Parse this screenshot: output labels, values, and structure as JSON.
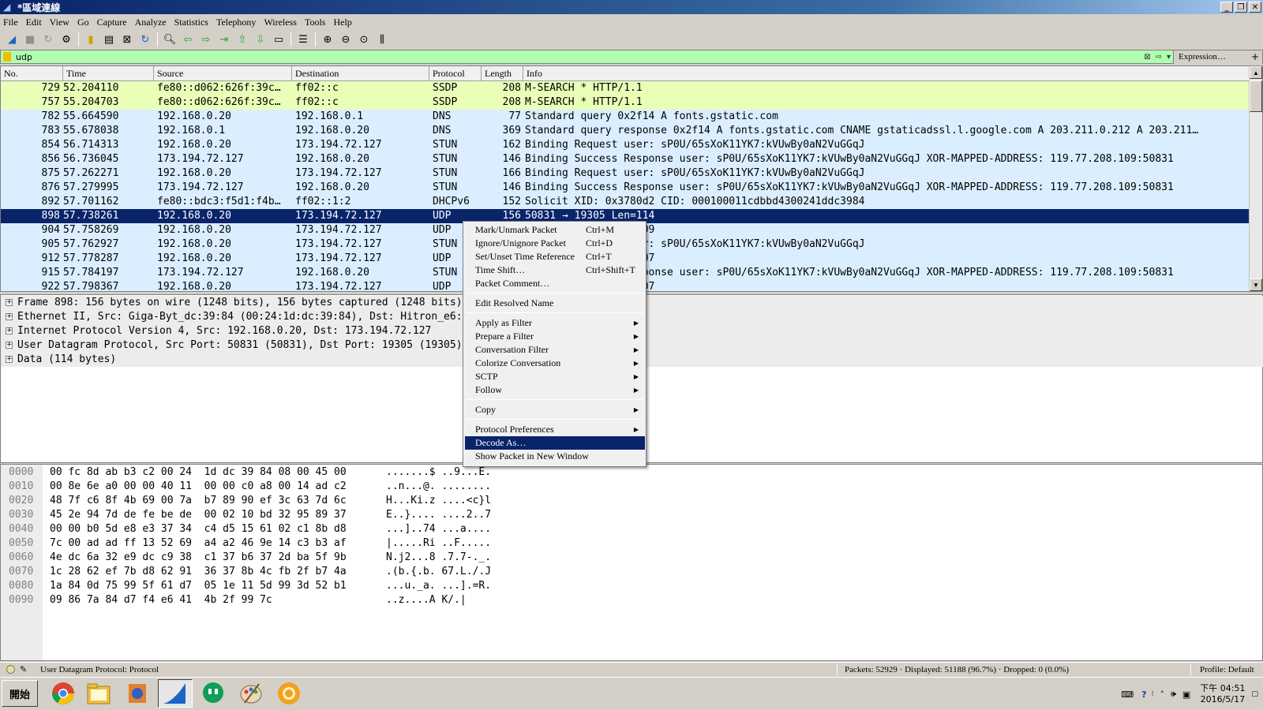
{
  "window": {
    "title": "*區域連線",
    "min": "_",
    "max": "❐",
    "close": "✕"
  },
  "menu": [
    "File",
    "Edit",
    "View",
    "Go",
    "Capture",
    "Analyze",
    "Statistics",
    "Telephony",
    "Wireless",
    "Tools",
    "Help"
  ],
  "filter": {
    "value": "udp",
    "expression_label": "Expression…",
    "plus": "+"
  },
  "columns": [
    "No.",
    "Time",
    "Source",
    "Destination",
    "Protocol",
    "Length",
    "Info"
  ],
  "packets": [
    {
      "no": "729",
      "time": "52.204110",
      "src": "fe80::d062:626f:39c…",
      "dst": "ff02::c",
      "proto": "SSDP",
      "len": "208",
      "info": "M-SEARCH * HTTP/1.1",
      "bg": "#e9ffb8"
    },
    {
      "no": "757",
      "time": "55.204703",
      "src": "fe80::d062:626f:39c…",
      "dst": "ff02::c",
      "proto": "SSDP",
      "len": "208",
      "info": "M-SEARCH * HTTP/1.1",
      "bg": "#e9ffb8"
    },
    {
      "no": "782",
      "time": "55.664590",
      "src": "192.168.0.20",
      "dst": "192.168.0.1",
      "proto": "DNS",
      "len": "77",
      "info": "Standard query 0x2f14 A fonts.gstatic.com",
      "bg": "#daeeff"
    },
    {
      "no": "783",
      "time": "55.678038",
      "src": "192.168.0.1",
      "dst": "192.168.0.20",
      "proto": "DNS",
      "len": "369",
      "info": "Standard query response 0x2f14 A fonts.gstatic.com CNAME gstaticadssl.l.google.com A 203.211.0.212 A 203.211…",
      "bg": "#daeeff"
    },
    {
      "no": "854",
      "time": "56.714313",
      "src": "192.168.0.20",
      "dst": "173.194.72.127",
      "proto": "STUN",
      "len": "162",
      "info": "Binding Request user: sP0U/65sXoK11YK7:kVUwBy0aN2VuGGqJ",
      "bg": "#daeeff"
    },
    {
      "no": "856",
      "time": "56.736045",
      "src": "173.194.72.127",
      "dst": "192.168.0.20",
      "proto": "STUN",
      "len": "146",
      "info": "Binding Success Response user: sP0U/65sXoK11YK7:kVUwBy0aN2VuGGqJ XOR-MAPPED-ADDRESS: 119.77.208.109:50831",
      "bg": "#daeeff"
    },
    {
      "no": "875",
      "time": "57.262271",
      "src": "192.168.0.20",
      "dst": "173.194.72.127",
      "proto": "STUN",
      "len": "166",
      "info": "Binding Request user: sP0U/65sXoK11YK7:kVUwBy0aN2VuGGqJ",
      "bg": "#daeeff"
    },
    {
      "no": "876",
      "time": "57.279995",
      "src": "173.194.72.127",
      "dst": "192.168.0.20",
      "proto": "STUN",
      "len": "146",
      "info": "Binding Success Response user: sP0U/65sXoK11YK7:kVUwBy0aN2VuGGqJ XOR-MAPPED-ADDRESS: 119.77.208.109:50831",
      "bg": "#daeeff"
    },
    {
      "no": "892",
      "time": "57.701162",
      "src": "fe80::bdc3:f5d1:f4b…",
      "dst": "ff02::1:2",
      "proto": "DHCPv6",
      "len": "152",
      "info": "Solicit XID: 0x3780d2 CID: 000100011cdbbd4300241ddc3984",
      "bg": "#daeeff"
    },
    {
      "no": "898",
      "time": "57.738261",
      "src": "192.168.0.20",
      "dst": "173.194.72.127",
      "proto": "UDP",
      "len": "156",
      "info": "50831 → 19305 Len=114",
      "bg": "#0a246a",
      "selected": true
    },
    {
      "no": "904",
      "time": "57.758269",
      "src": "192.168.0.20",
      "dst": "173.194.72.127",
      "proto": "UDP",
      "len": "151",
      "info": "50831 → 19305 Len=109",
      "bg": "#daeeff"
    },
    {
      "no": "905",
      "time": "57.762927",
      "src": "192.168.0.20",
      "dst": "173.194.72.127",
      "proto": "STUN",
      "len": "162",
      "info": "Binding Request user: sP0U/65sXoK11YK7:kVUwBy0aN2VuGGqJ",
      "bg": "#daeeff"
    },
    {
      "no": "912",
      "time": "57.778287",
      "src": "192.168.0.20",
      "dst": "173.194.72.127",
      "proto": "UDP",
      "len": "149",
      "info": "50831 → 19305 Len=107",
      "bg": "#daeeff"
    },
    {
      "no": "915",
      "time": "57.784197",
      "src": "173.194.72.127",
      "dst": "192.168.0.20",
      "proto": "STUN",
      "len": "146",
      "info": "Binding Success Response user: sP0U/65sXoK11YK7:kVUwBy0aN2VuGGqJ XOR-MAPPED-ADDRESS: 119.77.208.109:50831",
      "bg": "#daeeff"
    },
    {
      "no": "922",
      "time": "57.798367",
      "src": "192.168.0.20",
      "dst": "173.194.72.127",
      "proto": "UDP",
      "len": "149",
      "info": "50831 → 19305 Len=107",
      "bg": "#daeeff"
    }
  ],
  "details": [
    "Frame 898: 156 bytes on wire (1248 bits), 156 bytes captured (1248 bits) on interface 0",
    "Ethernet II, Src: Giga-Byt_dc:39:84 (00:24:1d:dc:39:84), Dst: Hitron_e6:ff:c2 (bc:14:01:e6:ff:c2)",
    "Internet Protocol Version 4, Src: 192.168.0.20, Dst: 173.194.72.127",
    "User Datagram Protocol, Src Port: 50831 (50831), Dst Port: 19305 (19305)",
    "Data (114 bytes)"
  ],
  "bytes": [
    {
      "off": "0000",
      "hex": "00 fc 8d ab b3 c2 00 24  1d dc 39 84 08 00 45 00",
      "asc": ".......$ ..9...E."
    },
    {
      "off": "0010",
      "hex": "00 8e 6e a0 00 00 40 11  00 00 c0 a8 00 14 ad c2",
      "asc": "..n...@. ........"
    },
    {
      "off": "0020",
      "hex": "48 7f c6 8f 4b 69 00 7a  b7 89 90 ef 3c 63 7d 6c",
      "asc": "H...Ki.z ....<c}l"
    },
    {
      "off": "0030",
      "hex": "45 2e 94 7d de fe be de  00 02 10 bd 32 95 89 37",
      "asc": "E..}.... ....2..7"
    },
    {
      "off": "0040",
      "hex": "00 00 b0 5d e8 e3 37 34  c4 d5 15 61 02 c1 8b d8",
      "asc": "...]..74 ...a...."
    },
    {
      "off": "0050",
      "hex": "7c 00 ad ad ff 13 52 69  a4 a2 46 9e 14 c3 b3 af",
      "asc": "|.....Ri ..F....."
    },
    {
      "off": "0060",
      "hex": "4e dc 6a 32 e9 dc c9 38  c1 37 b6 37 2d ba 5f 9b",
      "asc": "N.j2...8 .7.7-._."
    },
    {
      "off": "0070",
      "hex": "1c 28 62 ef 7b d8 62 91  36 37 8b 4c fb 2f b7 4a",
      "asc": ".(b.{.b. 67.L./.J"
    },
    {
      "off": "0080",
      "hex": "1a 84 0d 75 99 5f 61 d7  05 1e 11 5d 99 3d 52 b1",
      "asc": "...u._a. ...].=R."
    },
    {
      "off": "0090",
      "hex": "09 86 7a 84 d7 f4 e6 41  4b 2f 99 7c",
      "asc": "..z....A K/.|"
    }
  ],
  "context_menu": {
    "items": [
      {
        "label": "Mark/Unmark Packet",
        "shortcut": "Ctrl+M"
      },
      {
        "label": "Ignore/Unignore Packet",
        "shortcut": "Ctrl+D"
      },
      {
        "label": "Set/Unset Time Reference",
        "shortcut": "Ctrl+T"
      },
      {
        "label": "Time Shift…",
        "shortcut": "Ctrl+Shift+T"
      },
      {
        "label": "Packet Comment…",
        "shortcut": ""
      },
      {
        "sep": true
      },
      {
        "label": "Edit Resolved Name",
        "shortcut": ""
      },
      {
        "sep": true
      },
      {
        "label": "Apply as Filter",
        "submenu": true
      },
      {
        "label": "Prepare a Filter",
        "submenu": true
      },
      {
        "label": "Conversation Filter",
        "submenu": true
      },
      {
        "label": "Colorize Conversation",
        "submenu": true
      },
      {
        "label": "SCTP",
        "submenu": true
      },
      {
        "label": "Follow",
        "submenu": true
      },
      {
        "sep": true
      },
      {
        "label": "Copy",
        "submenu": true
      },
      {
        "sep": true
      },
      {
        "label": "Protocol Preferences",
        "submenu": true
      },
      {
        "label": "Decode As…",
        "highlighted": true
      },
      {
        "label": "Show Packet in New Window"
      }
    ]
  },
  "status": {
    "field": "User Datagram Protocol: Protocol",
    "packets": "Packets: 52929 · Displayed: 51188 (96.7%) · Dropped: 0 (0.0%)",
    "profile": "Profile: Default"
  },
  "taskbar": {
    "start": "開始",
    "apps": [
      "chrome-icon",
      "folder-icon",
      "firefox-icon",
      "wireshark-icon",
      "hangouts-icon",
      "paint-icon",
      "media-icon"
    ],
    "clock_time": "下午 04:51",
    "clock_date": "2016/5/17"
  },
  "colors": {
    "selected_row": "#0a246a",
    "ssdp_row": "#e9ffb8",
    "udp_row": "#daeeff",
    "filter_bg": "#afffaf"
  }
}
